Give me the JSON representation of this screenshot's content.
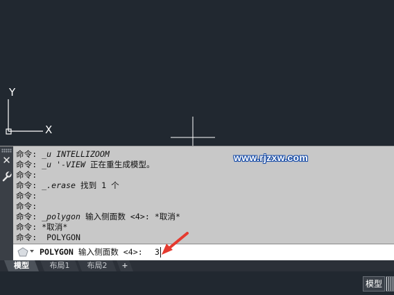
{
  "history": [
    {
      "prefix": "命令: ",
      "italic": "_u INTELLIZOOM",
      "rest": ""
    },
    {
      "prefix": "命令: ",
      "italic": "_u '-VIEW",
      "rest": " 正在重生成模型。"
    },
    {
      "prefix": "命令:",
      "italic": "",
      "rest": ""
    },
    {
      "prefix": "命令: ",
      "italic": "_.erase",
      "rest": " 找到 1 个"
    },
    {
      "prefix": "命令:",
      "italic": "",
      "rest": ""
    },
    {
      "prefix": "命令:",
      "italic": "",
      "rest": ""
    },
    {
      "prefix": "命令: ",
      "italic": "_polygon",
      "rest": " 输入侧面数 <4>: *取消*"
    },
    {
      "prefix": "命令: ",
      "italic": "",
      "rest": "*取消*"
    },
    {
      "prefix": "命令:  ",
      "italic": "",
      "rest": "POLYGON"
    }
  ],
  "watermark": "www.rjzxw.com",
  "prompt": {
    "command": "POLYGON",
    "text": " 输入侧面数 <4>: ",
    "input_value": "3",
    "icon": "polygon-icon"
  },
  "tabs": [
    {
      "label": "模型",
      "active": true
    },
    {
      "label": "布局1",
      "active": false
    },
    {
      "label": "布局2",
      "active": false
    },
    {
      "label": "+",
      "active": false
    }
  ],
  "ucs": {
    "x_label": "X",
    "y_label": "Y"
  },
  "status": {
    "model_label": "模型"
  },
  "colors": {
    "canvas": "#212830",
    "command_bg": "#c8c8c8",
    "arrow": "#e53a2f"
  }
}
